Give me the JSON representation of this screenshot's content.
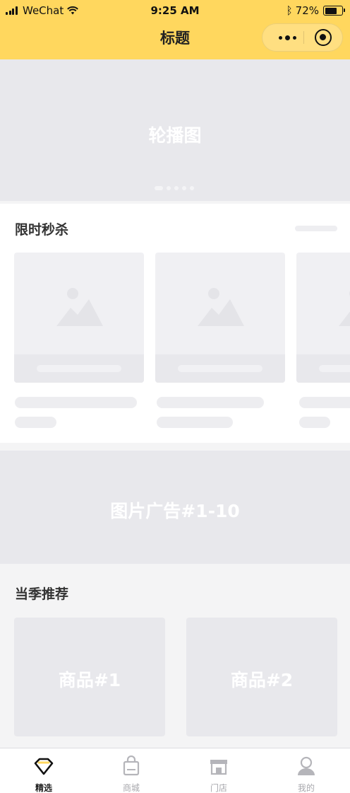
{
  "status_bar": {
    "carrier": "WeChat",
    "time": "9:25 AM",
    "battery": "72%"
  },
  "nav": {
    "title": "标题"
  },
  "banner": {
    "label": "轮播图"
  },
  "flash_sale": {
    "title": "限时秒杀"
  },
  "ad": {
    "label": "图片广告#1-10"
  },
  "recommend": {
    "title": "当季推荐",
    "products": [
      "商品#1",
      "商品#2"
    ]
  },
  "tabbar": {
    "items": [
      {
        "label": "精选",
        "icon": "diamond-icon"
      },
      {
        "label": "商城",
        "icon": "shopping-bag-icon"
      },
      {
        "label": "门店",
        "icon": "store-icon"
      },
      {
        "label": "我的",
        "icon": "user-icon"
      }
    ],
    "active_index": 0
  },
  "colors": {
    "header": "#ffd75e",
    "placeholder": "#e8e8ec",
    "accent": "#ffd75e"
  }
}
